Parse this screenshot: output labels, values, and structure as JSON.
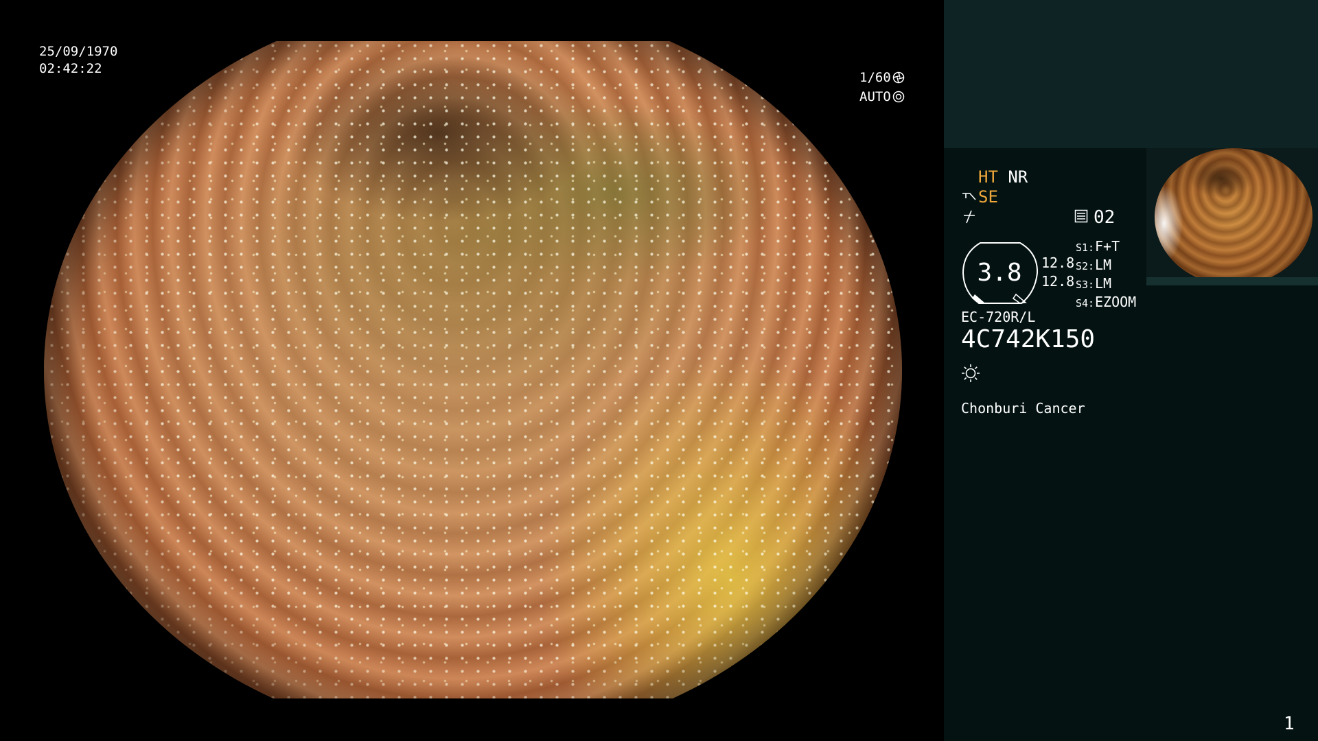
{
  "overlay": {
    "date": "25/09/1970",
    "time": "02:42:22",
    "shutter": "1/60",
    "iris_mode": "AUTO"
  },
  "panel": {
    "mode_ht": "HT",
    "mode_nr": "NR",
    "mode_se": "SE",
    "cf_value": "02",
    "gauge_value": "3.8",
    "gauge_side": [
      "12.8",
      "12.8"
    ],
    "switches": [
      {
        "key": "S1:",
        "value": "F+T"
      },
      {
        "key": "S2:",
        "value": "LM"
      },
      {
        "key": "S3:",
        "value": "LM"
      },
      {
        "key": "S4:",
        "value": "EZOOM"
      }
    ],
    "scope_model": "EC-720R/L",
    "serial": "4C742K150",
    "institution": "Chonburi Cancer",
    "page_number": "1"
  },
  "colors": {
    "accent_amber": "#f0a83a",
    "panel_bg": "#041312",
    "panel_top_bg": "#0e2424"
  },
  "icons": [
    "shutter-icon",
    "iris-icon",
    "scope-tip-icon",
    "signal-icon",
    "cf-icon",
    "brightness-icon"
  ]
}
